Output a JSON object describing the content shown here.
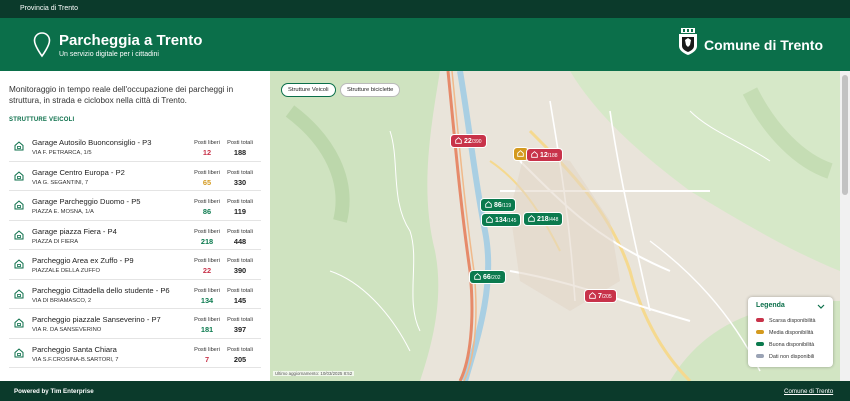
{
  "topbar": {
    "label": "Provincia di Trento"
  },
  "header": {
    "title": "Parcheggia a Trento",
    "subtitle": "Un servizio digitale per i cittadini",
    "brand": "Comune di Trento"
  },
  "intro": {
    "text": "Monitoraggio in tempo reale dell'occupazione dei parcheggi in struttura, in strada e ciclobox nella città di Trento.",
    "section_label": "STRUTTURE VEICOLI"
  },
  "parking_list": {
    "free_label": "Posti liberi",
    "total_label": "Posti totali",
    "items": [
      {
        "name": "Garage Autosilo Buonconsiglio - P3",
        "address": "VIA F. PETRARCA, 1/5",
        "free": "12",
        "total": "188",
        "status": "scarsa"
      },
      {
        "name": "Garage Centro Europa - P2",
        "address": "VIA G. SEGANTINI, 7",
        "free": "65",
        "total": "330",
        "status": "media"
      },
      {
        "name": "Garage Parcheggio Duomo - P5",
        "address": "PIAZZA E. MOSNA, 1/A",
        "free": "86",
        "total": "119",
        "status": "buona"
      },
      {
        "name": "Garage piazza Fiera - P4",
        "address": "PIAZZA DI FIERA",
        "free": "218",
        "total": "448",
        "status": "buona"
      },
      {
        "name": "Parcheggio Area ex Zuffo - P9",
        "address": "PIAZZALE DELLA ZUFFO",
        "free": "22",
        "total": "390",
        "status": "scarsa"
      },
      {
        "name": "Parcheggio Cittadella dello studente - P6",
        "address": "VIA DI BRIAMASCO, 2",
        "free": "134",
        "total": "145",
        "status": "buona"
      },
      {
        "name": "Parcheggio piazzale Sanseverino - P7",
        "address": "VIA R. DA SANSEVERINO",
        "free": "181",
        "total": "397",
        "status": "buona"
      },
      {
        "name": "Parcheggio Santa Chiara",
        "address": "VIA S.F.CROSINA-B.SARTORI, 7",
        "free": "7",
        "total": "205",
        "status": "scarsa"
      }
    ]
  },
  "map": {
    "tabs": [
      {
        "label": "Strutture Veicoli",
        "active": true
      },
      {
        "label": "Strutture biciclette",
        "active": false
      }
    ],
    "markers": [
      {
        "free": "22",
        "total": "/390",
        "status": "scarsa"
      },
      {
        "free": "",
        "total": "",
        "status": "media"
      },
      {
        "free": "12",
        "total": "/188",
        "status": "scarsa"
      },
      {
        "free": "86",
        "total": "/119",
        "status": "buona"
      },
      {
        "free": "134",
        "total": "/145",
        "status": "buona"
      },
      {
        "free": "218",
        "total": "/448",
        "status": "buona"
      },
      {
        "free": "66",
        "total": "/202",
        "status": "buona"
      },
      {
        "free": "7",
        "total": "/205",
        "status": "scarsa"
      }
    ],
    "updated": "Ultimo aggiornamento: 10/03/2025 8:52",
    "legend": {
      "title": "Legenda",
      "items": [
        {
          "label": "Scarsa disponibilità",
          "color": "#c8334a"
        },
        {
          "label": "Media disponibilità",
          "color": "#d49a1e"
        },
        {
          "label": "Buona disponibilità",
          "color": "#0b7a4e"
        },
        {
          "label": "Dati non disponibili",
          "color": "#9aa3b5"
        }
      ]
    }
  },
  "colors": {
    "scarsa": "#c8334a",
    "media": "#d49a1e",
    "buona": "#0b7a4e",
    "brand_dark": "#0b3a2b",
    "brand": "#0b6f4a"
  },
  "footer": {
    "powered": "Powered by Tim Enterprise",
    "link": "Comune di Trento"
  }
}
